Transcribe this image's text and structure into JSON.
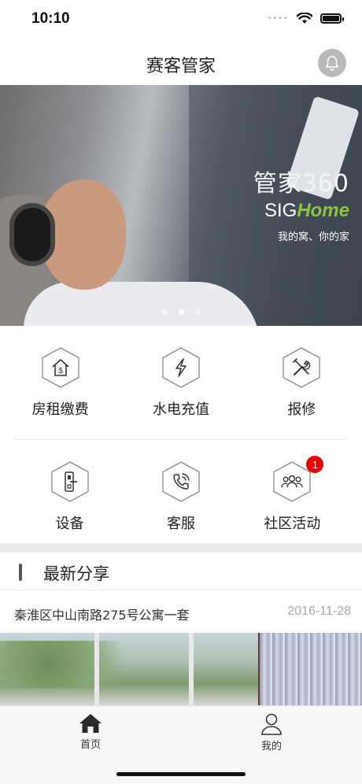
{
  "status_bar": {
    "time": "10:10"
  },
  "nav": {
    "title": "赛客管家"
  },
  "banner": {
    "logo_text": "管家360",
    "brand_prefix": "SIG",
    "brand_suffix": "Home",
    "slogan": "我的窝、你的家",
    "active_slide": 2,
    "slide_count": 3
  },
  "services": [
    {
      "label": "房租缴费",
      "icon": "rent-house-icon"
    },
    {
      "label": "水电充值",
      "icon": "lightning-icon"
    },
    {
      "label": "报修",
      "icon": "repair-tools-icon"
    },
    {
      "label": "设备",
      "icon": "door-lock-icon"
    },
    {
      "label": "客服",
      "icon": "phone-call-icon"
    },
    {
      "label": "社区活动",
      "icon": "community-icon",
      "badge": "1"
    }
  ],
  "latest_share": {
    "title": "最新分享",
    "items": [
      {
        "title": "秦淮区中山南路275号公寓一套",
        "date": "2016-11-28"
      }
    ]
  },
  "tabbar": {
    "tabs": [
      {
        "label": "首页",
        "icon": "home-icon"
      },
      {
        "label": "我的",
        "icon": "person-icon"
      }
    ]
  },
  "colors": {
    "badge": "#e60000",
    "accent": "#8cc63f",
    "icon_stroke": "#333333"
  }
}
